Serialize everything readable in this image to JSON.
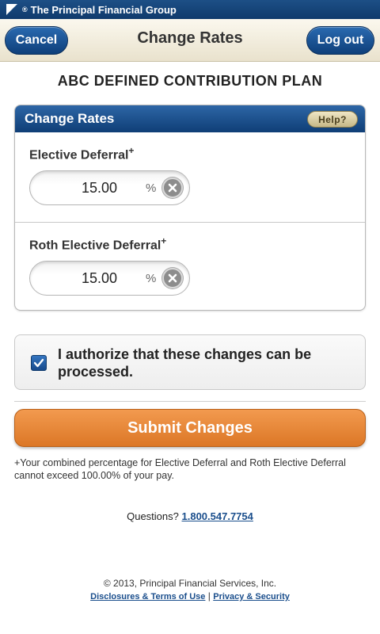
{
  "brand": {
    "reg_mark": "®",
    "name": "The Principal Financial Group"
  },
  "nav": {
    "cancel_label": "Cancel",
    "title": "Change Rates",
    "logout_label": "Log out"
  },
  "plan_title": "ABC DEFINED CONTRIBUTION PLAN",
  "panel": {
    "title": "Change Rates",
    "help_label": "Help?",
    "fields": [
      {
        "label": "Elective Deferral",
        "sup": "+",
        "value": "15.00",
        "unit": "%"
      },
      {
        "label": "Roth Elective Deferral",
        "sup": "+",
        "value": "15.00",
        "unit": "%"
      }
    ]
  },
  "authorization": {
    "checked": true,
    "text": "I authorize that these changes can be processed."
  },
  "submit_label": "Submit Changes",
  "footnote": "+Your combined percentage for Elective Deferral and Roth Elective Deferral cannot exceed 100.00% of your pay.",
  "questions": {
    "label": "Questions?",
    "phone": "1.800.547.7754"
  },
  "footer": {
    "copyright": "© 2013, Principal Financial Services, Inc.",
    "link_disclosures": "Disclosures & Terms of Use",
    "separator": "|",
    "link_privacy": "Privacy & Security"
  },
  "colors": {
    "brand_blue": "#0f3a6c",
    "accent_orange": "#dc7726",
    "nav_beige": "#e9e2cd"
  }
}
